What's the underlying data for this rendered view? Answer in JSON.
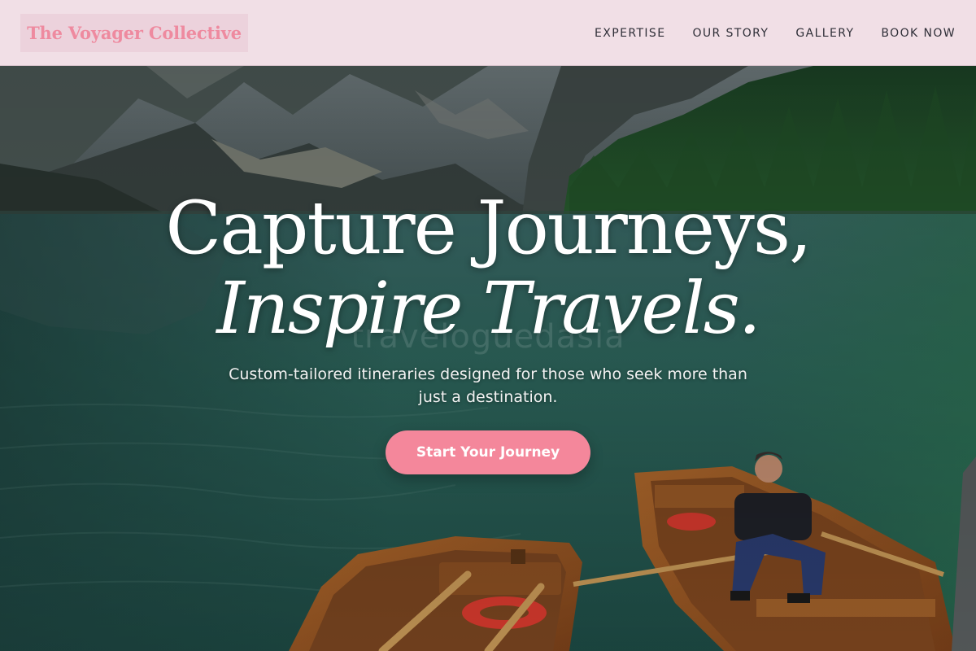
{
  "header": {
    "brand": "The Voyager Collective",
    "nav": [
      {
        "label": "EXPERTISE"
      },
      {
        "label": "OUR STORY"
      },
      {
        "label": "GALLERY"
      },
      {
        "label": "BOOK NOW"
      }
    ]
  },
  "hero": {
    "title_line1": "Capture Journeys,",
    "title_line2": "Inspire Travels.",
    "subtitle": "Custom-tailored itineraries designed for those who seek more than just a destination.",
    "cta_label": "Start Your Journey",
    "watermark": "traveloguedasia"
  },
  "colors": {
    "accent": "#f4879b",
    "brand_text": "#ee8a9f",
    "header_bg": "#f1dfe6"
  }
}
